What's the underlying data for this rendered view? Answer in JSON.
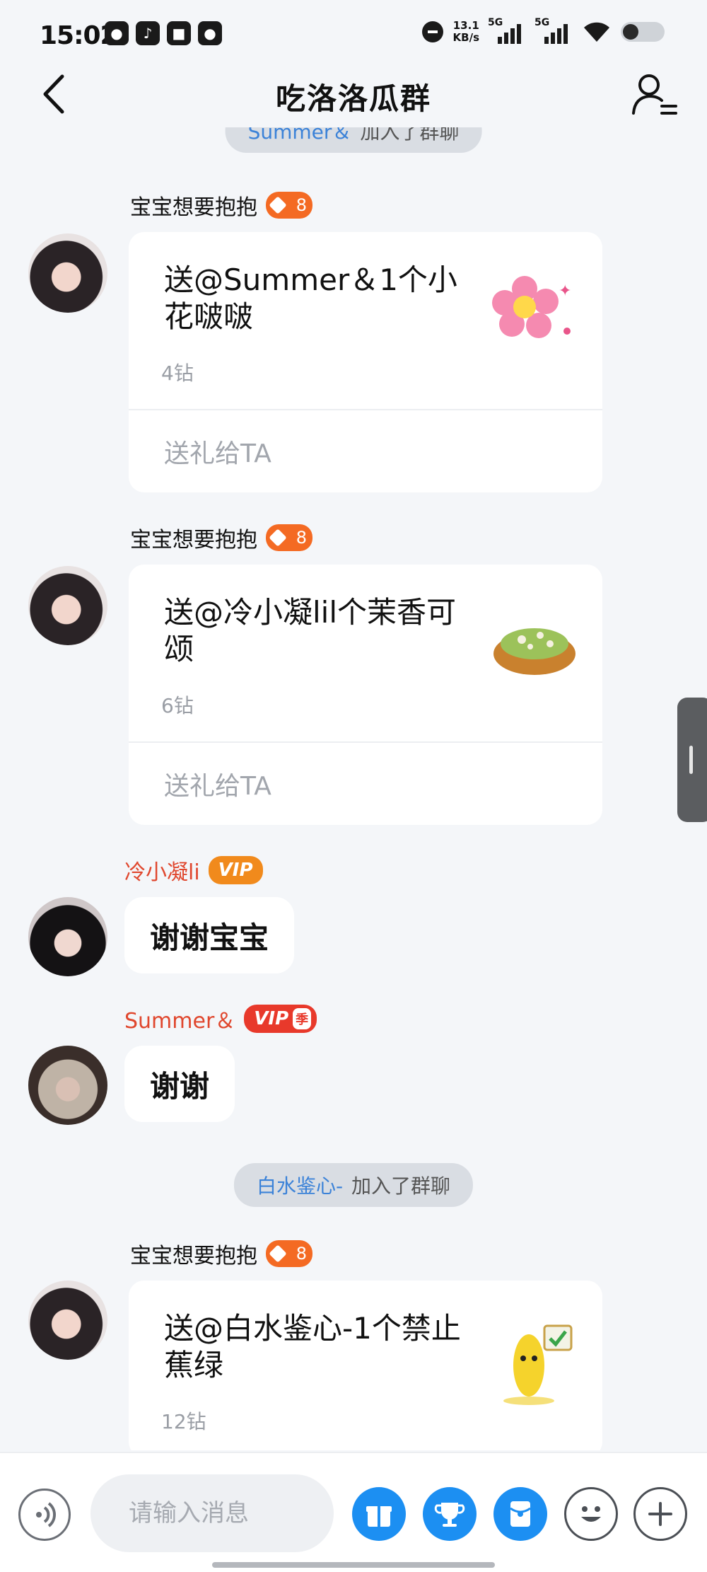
{
  "status_bar": {
    "time": "15:02",
    "net_speed_value": "13.1",
    "net_speed_unit": "KB/s",
    "signal1_label": "5G",
    "signal2_label": "5G"
  },
  "header": {
    "title": "吃洛洛瓜群"
  },
  "messages": {
    "notice_top": {
      "user": "Summer＆",
      "text": "加入了群聊"
    },
    "gift1": {
      "sender": "宝宝想要抱抱",
      "level": "8",
      "text": "送@Summer＆1个小花啵啵",
      "price": "4钻",
      "action": "送礼给TA"
    },
    "gift2": {
      "sender": "宝宝想要抱抱",
      "level": "8",
      "text": "送@冷小凝lil个茉香可颂",
      "price": "6钻",
      "action": "送礼给TA"
    },
    "msg3": {
      "sender": "冷小凝li",
      "badge": "VIP",
      "text": "谢谢宝宝"
    },
    "msg4": {
      "sender": "Summer＆",
      "badge": "VIP",
      "badge_season": "季",
      "text": "谢谢"
    },
    "notice_mid": {
      "user": "白水鉴心-",
      "text": "加入了群聊"
    },
    "gift3": {
      "sender": "宝宝想要抱抱",
      "level": "8",
      "text": "送@白水鉴心-1个禁止蕉绿",
      "price": "12钻"
    }
  },
  "input": {
    "placeholder": "请输入消息"
  },
  "colors": {
    "background": "#f4f6f9",
    "accent_blue": "#1c8ff2",
    "level_orange": "#f46a23",
    "vip_orange": "#f18a1c",
    "vip_red": "#e8392b",
    "name_red": "#e0472e",
    "notice_user_blue": "#3b82d8"
  },
  "icons": {
    "back": "chevron-left-icon",
    "members": "group-members-icon",
    "voice": "voice-icon",
    "gift": "gift-icon",
    "trophy": "trophy-icon",
    "red_packet": "red-packet-icon",
    "emoji": "emoji-icon",
    "plus": "plus-icon"
  }
}
